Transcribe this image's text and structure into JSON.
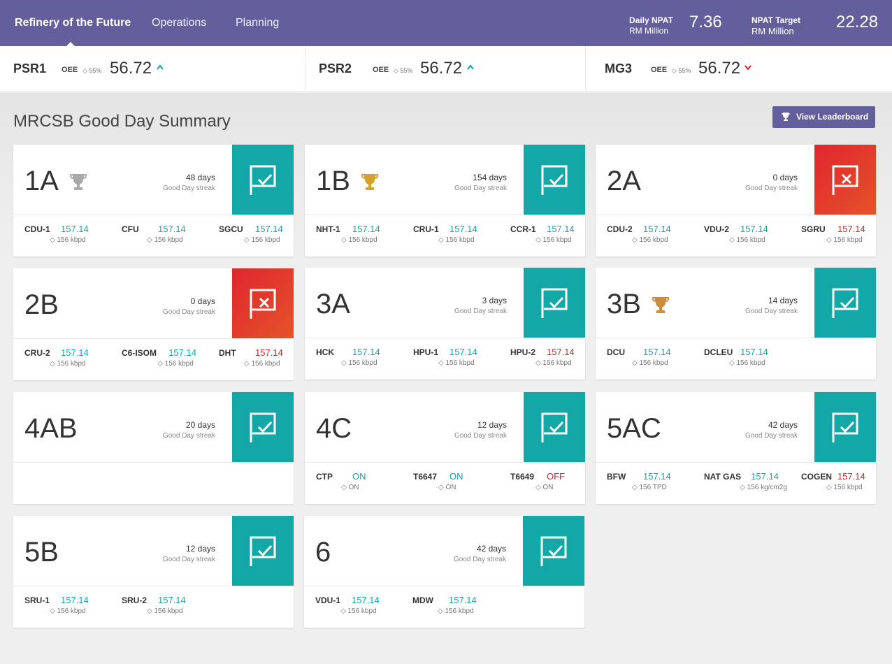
{
  "header": {
    "brand": "Refinery of the Future",
    "nav": [
      "Operations",
      "Planning"
    ],
    "daily_npat": {
      "label": "Daily NPAT",
      "sub": "RM Million",
      "value": "7.36"
    },
    "npat_target": {
      "label": "NPAT Target",
      "sub": "RM Million",
      "value": "22.28"
    }
  },
  "units": [
    {
      "name": "PSR1",
      "oee_label": "OEE",
      "target": "◇ 55%",
      "value": "56.72",
      "trend": "up"
    },
    {
      "name": "PSR2",
      "oee_label": "OEE",
      "target": "◇ 55%",
      "value": "56.72",
      "trend": "up"
    },
    {
      "name": "MG3",
      "oee_label": "OEE",
      "target": "◇ 55%",
      "value": "56.72",
      "trend": "down"
    }
  ],
  "colors": {
    "header_bg": "#635f9c",
    "good": "#14a7a8",
    "bad": "#e0262e"
  },
  "section": {
    "title": "MRCSB Good Day Summary",
    "leaderboard_button": "View Leaderboard"
  },
  "cards": [
    {
      "code": "1A",
      "trophy": "silver",
      "days": "48 days",
      "streak_label": "Good Day streak",
      "status": "good",
      "metrics": [
        {
          "name": "CDU-1",
          "value": "157.14",
          "sub": "◇ 156 kbpd",
          "state": "up"
        },
        {
          "name": "CFU",
          "value": "157.14",
          "sub": "◇ 156 kbpd",
          "state": "up"
        },
        {
          "name": "SGCU",
          "value": "157.14",
          "sub": "◇ 156 kbpd",
          "state": "up"
        }
      ]
    },
    {
      "code": "1B",
      "trophy": "gold",
      "days": "154 days",
      "streak_label": "Good Day streak",
      "status": "good",
      "metrics": [
        {
          "name": "NHT-1",
          "value": "157.14",
          "sub": "◇ 156 kbpd",
          "state": "up"
        },
        {
          "name": "CRU-1",
          "value": "157.14",
          "sub": "◇ 156 kbpd",
          "state": "up"
        },
        {
          "name": "CCR-1",
          "value": "157.14",
          "sub": "◇ 156 kbpd",
          "state": "up"
        }
      ]
    },
    {
      "code": "2A",
      "trophy": "none",
      "days": "0 days",
      "streak_label": "Good Day streak",
      "status": "bad",
      "metrics": [
        {
          "name": "CDU-2",
          "value": "157.14",
          "sub": "◇ 156 kbpd",
          "state": "up"
        },
        {
          "name": "VDU-2",
          "value": "157.14",
          "sub": "◇ 156 kbpd",
          "state": "up"
        },
        {
          "name": "SGRU",
          "value": "157.14",
          "sub": "◇ 156 kbpd",
          "state": "down"
        }
      ]
    },
    {
      "code": "2B",
      "trophy": "none",
      "days": "0 days",
      "streak_label": "Good Day streak",
      "status": "bad",
      "metrics": [
        {
          "name": "CRU-2",
          "value": "157.14",
          "sub": "◇ 156 kbpd",
          "state": "up"
        },
        {
          "name": "C6-ISOM",
          "value": "157.14",
          "sub": "◇ 156 kbpd",
          "state": "up"
        },
        {
          "name": "DHT",
          "value": "157.14",
          "sub": "◇ 156 kbpd",
          "state": "down"
        }
      ]
    },
    {
      "code": "3A",
      "trophy": "none",
      "days": "3 days",
      "streak_label": "Good Day streak",
      "status": "good",
      "metrics": [
        {
          "name": "HCK",
          "value": "157.14",
          "sub": "◇ 156 kbpd",
          "state": "up"
        },
        {
          "name": "HPU-1",
          "value": "157.14",
          "sub": "◇ 156 kbpd",
          "state": "up"
        },
        {
          "name": "HPU-2",
          "value": "157.14",
          "sub": "◇ 156 kbpd",
          "state": "down"
        }
      ]
    },
    {
      "code": "3B",
      "trophy": "bronze",
      "days": "14 days",
      "streak_label": "Good Day streak",
      "status": "good",
      "metrics": [
        {
          "name": "DCU",
          "value": "157.14",
          "sub": "◇ 156 kbpd",
          "state": "up"
        },
        {
          "name": "DCLEU",
          "value": "157.14",
          "sub": "◇ 156 kbpd",
          "state": "up"
        }
      ]
    },
    {
      "code": "4AB",
      "trophy": "none",
      "days": "20 days",
      "streak_label": "Good Day streak",
      "status": "good",
      "metrics": []
    },
    {
      "code": "4C",
      "trophy": "none",
      "days": "12 days",
      "streak_label": "Good Day streak",
      "status": "good",
      "metrics": [
        {
          "name": "CTP",
          "value": "ON",
          "sub": "◇ ON",
          "state": "up"
        },
        {
          "name": "T6647",
          "value": "ON",
          "sub": "◇ ON",
          "state": "up"
        },
        {
          "name": "T6649",
          "value": "OFF",
          "sub": "◇ ON",
          "state": "down"
        }
      ]
    },
    {
      "code": "5AC",
      "trophy": "none",
      "days": "42 days",
      "streak_label": "Good Day streak",
      "status": "good",
      "metrics": [
        {
          "name": "BFW",
          "value": "157.14",
          "sub": "◇ 156 TPD",
          "state": "up"
        },
        {
          "name": "NAT GAS",
          "value": "157.14",
          "sub": "◇ 156 kg/cm2g",
          "state": "up"
        },
        {
          "name": "COGEN",
          "value": "157.14",
          "sub": "◇ 156 kbpd",
          "state": "down"
        }
      ]
    },
    {
      "code": "5B",
      "trophy": "none",
      "days": "12 days",
      "streak_label": "Good Day streak",
      "status": "good",
      "metrics": [
        {
          "name": "SRU-1",
          "value": "157.14",
          "sub": "◇ 156 kbpd",
          "state": "up"
        },
        {
          "name": "SRU-2",
          "value": "157.14",
          "sub": "◇ 156 kbpd",
          "state": "up"
        }
      ]
    },
    {
      "code": "6",
      "trophy": "none",
      "days": "42 days",
      "streak_label": "Good Day streak",
      "status": "good",
      "metrics": [
        {
          "name": "VDU-1",
          "value": "157.14",
          "sub": "◇ 156 kbpd",
          "state": "up"
        },
        {
          "name": "MDW",
          "value": "157.14",
          "sub": "◇ 156 kbpd",
          "state": "up"
        }
      ]
    }
  ]
}
